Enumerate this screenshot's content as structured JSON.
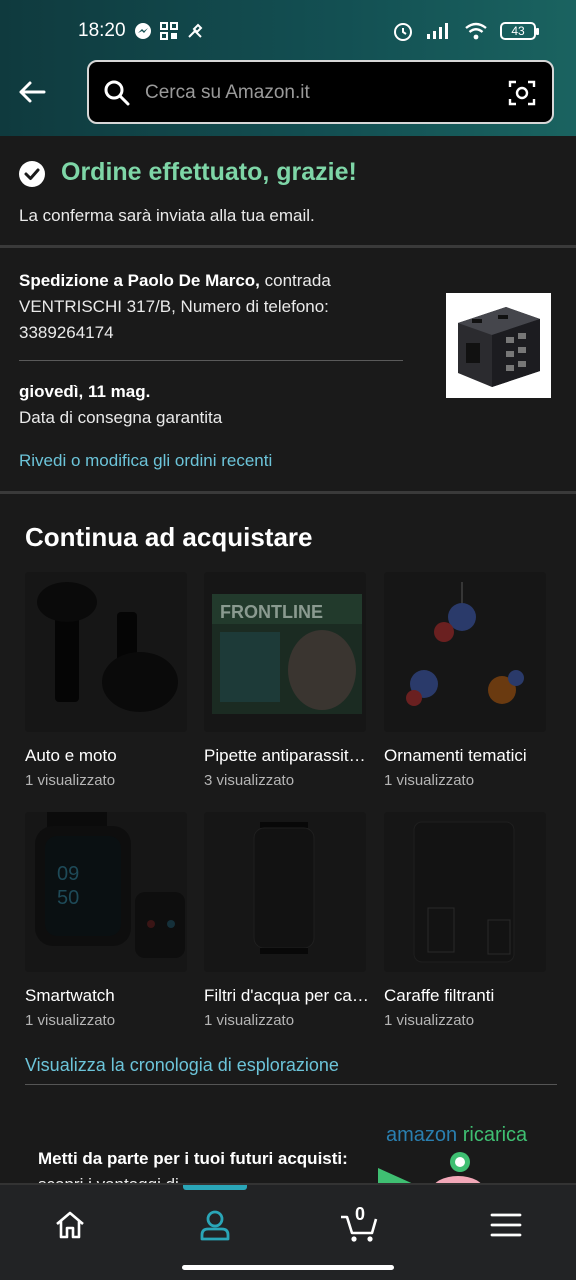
{
  "status_bar": {
    "time": "18:20",
    "battery": "43"
  },
  "search": {
    "placeholder": "Cerca su Amazon.it"
  },
  "confirmation": {
    "title": "Ordine effettuato, grazie!",
    "subtitle": "La conferma sarà inviata alla tua email."
  },
  "shipping": {
    "recipient_bold": "Spedizione a Paolo De Marco,",
    "address": " contrada VENTRISCHI 317/B, Numero di telefono: 3389264174",
    "delivery_date": "giovedì, 11 mag.",
    "delivery_note": "Data di consegna garantita",
    "review_link": "Rivedi o modifica gli ordini recenti"
  },
  "continue": {
    "heading": "Continua ad acquistare",
    "items": [
      {
        "name": "Auto e moto",
        "views": "1 visualizzato",
        "icon": "dumbbell-image"
      },
      {
        "name": "Pipette antiparassitarie",
        "views": "3 visualizzato",
        "icon": "frontline-box-image"
      },
      {
        "name": "Ornamenti tematici",
        "views": "1 visualizzato",
        "icon": "ornaments-image"
      },
      {
        "name": "Smartwatch",
        "views": "1 visualizzato",
        "icon": "smartwatch-image"
      },
      {
        "name": "Filtri d'acqua per caraffe",
        "views": "1 visualizzato",
        "icon": "water-filter-image"
      },
      {
        "name": "Caraffe filtranti",
        "views": "1 visualizzato",
        "icon": "filter-jug-image"
      }
    ],
    "history_link": "Visualizza la cronologia di esplorazione"
  },
  "promo": {
    "text_bold": "Metti da parte per i tuoi futuri acquisti:",
    "text": " scopri i vantaggi di",
    "brand_amazon": "amazon",
    "brand_ricarica": "ricarica"
  },
  "nav": {
    "cart_count": "0"
  },
  "colors": {
    "accent_green": "#7ed6a7",
    "link_blue": "#6cc4d9",
    "header_teal": "#135053",
    "nav_indicator": "#2aa6b8"
  }
}
